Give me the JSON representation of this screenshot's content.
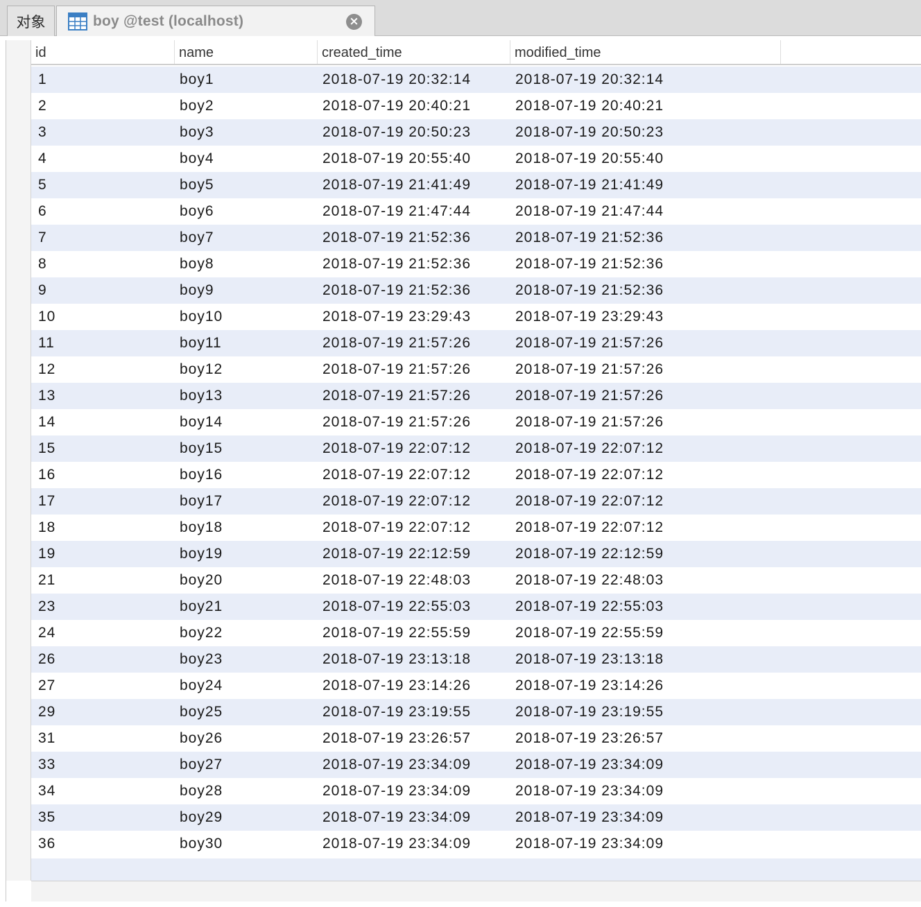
{
  "tabs": {
    "objects_label": "对象",
    "table_tab_label": "boy @test (localhost)",
    "close_glyph": "×"
  },
  "columns": [
    "id",
    "name",
    "created_time",
    "modified_time"
  ],
  "rows": [
    {
      "id": "1",
      "name": "boy1",
      "created_time": "2018-07-19 20:32:14",
      "modified_time": "2018-07-19 20:32:14"
    },
    {
      "id": "2",
      "name": "boy2",
      "created_time": "2018-07-19 20:40:21",
      "modified_time": "2018-07-19 20:40:21"
    },
    {
      "id": "3",
      "name": "boy3",
      "created_time": "2018-07-19 20:50:23",
      "modified_time": "2018-07-19 20:50:23"
    },
    {
      "id": "4",
      "name": "boy4",
      "created_time": "2018-07-19 20:55:40",
      "modified_time": "2018-07-19 20:55:40"
    },
    {
      "id": "5",
      "name": "boy5",
      "created_time": "2018-07-19 21:41:49",
      "modified_time": "2018-07-19 21:41:49"
    },
    {
      "id": "6",
      "name": "boy6",
      "created_time": "2018-07-19 21:47:44",
      "modified_time": "2018-07-19 21:47:44"
    },
    {
      "id": "7",
      "name": "boy7",
      "created_time": "2018-07-19 21:52:36",
      "modified_time": "2018-07-19 21:52:36"
    },
    {
      "id": "8",
      "name": "boy8",
      "created_time": "2018-07-19 21:52:36",
      "modified_time": "2018-07-19 21:52:36"
    },
    {
      "id": "9",
      "name": "boy9",
      "created_time": "2018-07-19 21:52:36",
      "modified_time": "2018-07-19 21:52:36"
    },
    {
      "id": "10",
      "name": "boy10",
      "created_time": "2018-07-19 23:29:43",
      "modified_time": "2018-07-19 23:29:43"
    },
    {
      "id": "11",
      "name": "boy11",
      "created_time": "2018-07-19 21:57:26",
      "modified_time": "2018-07-19 21:57:26"
    },
    {
      "id": "12",
      "name": "boy12",
      "created_time": "2018-07-19 21:57:26",
      "modified_time": "2018-07-19 21:57:26"
    },
    {
      "id": "13",
      "name": "boy13",
      "created_time": "2018-07-19 21:57:26",
      "modified_time": "2018-07-19 21:57:26"
    },
    {
      "id": "14",
      "name": "boy14",
      "created_time": "2018-07-19 21:57:26",
      "modified_time": "2018-07-19 21:57:26"
    },
    {
      "id": "15",
      "name": "boy15",
      "created_time": "2018-07-19 22:07:12",
      "modified_time": "2018-07-19 22:07:12"
    },
    {
      "id": "16",
      "name": "boy16",
      "created_time": "2018-07-19 22:07:12",
      "modified_time": "2018-07-19 22:07:12"
    },
    {
      "id": "17",
      "name": "boy17",
      "created_time": "2018-07-19 22:07:12",
      "modified_time": "2018-07-19 22:07:12"
    },
    {
      "id": "18",
      "name": "boy18",
      "created_time": "2018-07-19 22:07:12",
      "modified_time": "2018-07-19 22:07:12"
    },
    {
      "id": "19",
      "name": "boy19",
      "created_time": "2018-07-19 22:12:59",
      "modified_time": "2018-07-19 22:12:59"
    },
    {
      "id": "21",
      "name": "boy20",
      "created_time": "2018-07-19 22:48:03",
      "modified_time": "2018-07-19 22:48:03"
    },
    {
      "id": "23",
      "name": "boy21",
      "created_time": "2018-07-19 22:55:03",
      "modified_time": "2018-07-19 22:55:03"
    },
    {
      "id": "24",
      "name": "boy22",
      "created_time": "2018-07-19 22:55:59",
      "modified_time": "2018-07-19 22:55:59"
    },
    {
      "id": "26",
      "name": "boy23",
      "created_time": "2018-07-19 23:13:18",
      "modified_time": "2018-07-19 23:13:18"
    },
    {
      "id": "27",
      "name": "boy24",
      "created_time": "2018-07-19 23:14:26",
      "modified_time": "2018-07-19 23:14:26"
    },
    {
      "id": "29",
      "name": "boy25",
      "created_time": "2018-07-19 23:19:55",
      "modified_time": "2018-07-19 23:19:55"
    },
    {
      "id": "31",
      "name": "boy26",
      "created_time": "2018-07-19 23:26:57",
      "modified_time": "2018-07-19 23:26:57"
    },
    {
      "id": "33",
      "name": "boy27",
      "created_time": "2018-07-19 23:34:09",
      "modified_time": "2018-07-19 23:34:09"
    },
    {
      "id": "34",
      "name": "boy28",
      "created_time": "2018-07-19 23:34:09",
      "modified_time": "2018-07-19 23:34:09"
    },
    {
      "id": "35",
      "name": "boy29",
      "created_time": "2018-07-19 23:34:09",
      "modified_time": "2018-07-19 23:34:09"
    },
    {
      "id": "36",
      "name": "boy30",
      "created_time": "2018-07-19 23:34:09",
      "modified_time": "2018-07-19 23:34:09"
    }
  ],
  "colors": {
    "row_stripe": "#e8edf8",
    "tab_icon": "#3b7fc4"
  },
  "icons": {
    "table_tab_icon": "table-grid-icon",
    "close_icon": "close-circle-icon"
  }
}
